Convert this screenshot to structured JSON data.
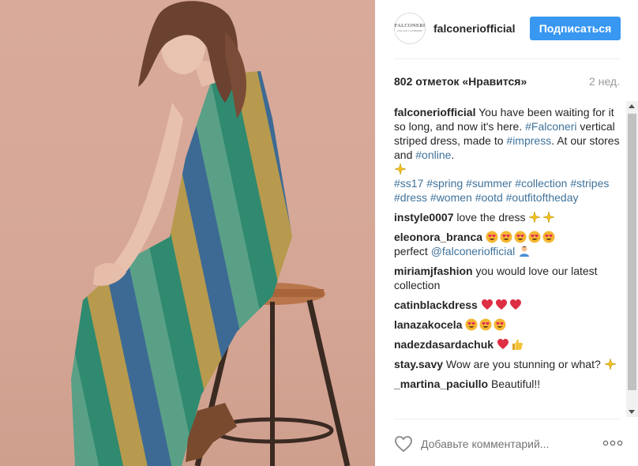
{
  "post": {
    "username": "falconeriofficial",
    "avatar_text": "FALCONERI",
    "avatar_subtext": "ITALIAN CASHMERE",
    "follow_label": "Подписаться",
    "likes": "802 отметок «Нравится»",
    "time_ago": "2 нед."
  },
  "caption": {
    "user": "falconeriofficial",
    "text1": "You have been waiting for it so long, and now it's here.",
    "tag_falconeri": "#Falconeri",
    "text2": "vertical striped dress, made to",
    "tag_impress": "#impress",
    "text3": ". At our stores and",
    "tag_online": "#online",
    "text4": ".",
    "hashtags": "#ss17 #spring #summer #collection #stripes #dress #women #ootd #outfitoftheday"
  },
  "comments": [
    {
      "user": "instyle0007",
      "text": "love the dress"
    },
    {
      "user": "eleonora_branca",
      "text": "perfect",
      "mention": "@falconeriofficial"
    },
    {
      "user": "miriamjfashion",
      "text": "you would love our latest collection"
    },
    {
      "user": "catinblackdress",
      "text": ""
    },
    {
      "user": "lanazakocela",
      "text": ""
    },
    {
      "user": "nadezdasardachuk",
      "text": ""
    },
    {
      "user": "stay.savy",
      "text": "Wow are you stunning or what?"
    },
    {
      "user": "_martina_paciullo",
      "text": "Beautiful!!"
    }
  ],
  "footer": {
    "comment_placeholder": "Добавьте комментарий...",
    "heart_icon": "heart-outline-icon",
    "more_icon": "more-options-icon"
  },
  "colors": {
    "accent": "#3897f0",
    "hashtag": "#3f729b",
    "background_photo": "#d6a796"
  }
}
